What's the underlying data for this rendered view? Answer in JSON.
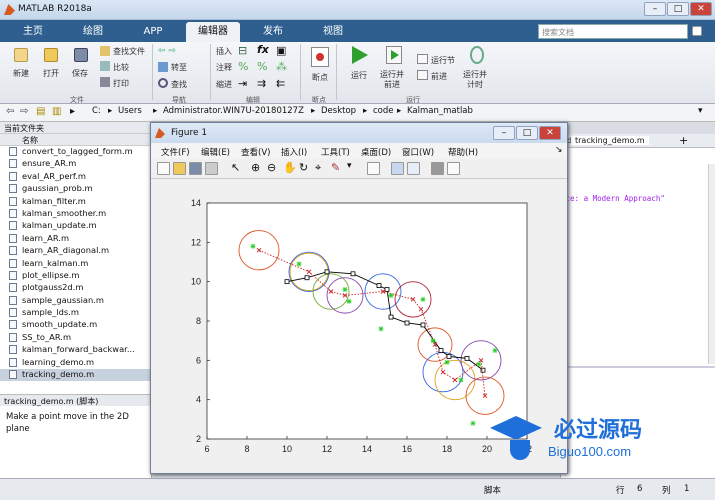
{
  "window": {
    "title": "MATLAB R2018a"
  },
  "tabs": [
    "主页",
    "绘图",
    "APP",
    "编辑器",
    "发布",
    "视图"
  ],
  "search": {
    "placeholder": "搜索文档"
  },
  "ribbon": {
    "file_group": {
      "new": "新建",
      "open": "打开",
      "save": "保存",
      "find_files": "查找文件",
      "compare": "比较",
      "print": "打印",
      "label": "文件"
    },
    "nav_group": {
      "goto": "转至",
      "find": "查找",
      "label": "导航"
    },
    "edit_group": {
      "insert": "插入",
      "comment": "注释",
      "indent": "缩进",
      "label": "编辑"
    },
    "breakpoint_group": {
      "breakpoints": "断点",
      "label": "断点"
    },
    "run_group": {
      "run": "运行",
      "run_advance": "运行并\n前进",
      "run_section": "运行节",
      "advance": "前进",
      "run_time": "运行并\n计时",
      "label": "运行"
    }
  },
  "address": {
    "parts": [
      "C:",
      "Users",
      "Administrator.WIN7U-20180127Z",
      "Desktop",
      "code",
      "Kalman_matlab"
    ]
  },
  "current_folder": {
    "title": "当前文件夹",
    "name_header": "名称",
    "files": [
      "convert_to_lagged_form.m",
      "ensure_AR.m",
      "eval_AR_perf.m",
      "gaussian_prob.m",
      "kalman_filter.m",
      "kalman_smoother.m",
      "kalman_update.m",
      "learn_AR.m",
      "learn_AR_diagonal.m",
      "learn_kalman.m",
      "plot_ellipse.m",
      "plotgauss2d.m",
      "sample_gaussian.m",
      "sample_lds.m",
      "smooth_update.m",
      "SS_to_AR.m",
      "kalman_forward_backwar...",
      "learning_demo.m",
      "tracking_demo.m"
    ],
    "selected": "tracking_demo.m"
  },
  "details": {
    "file": "tracking_demo.m",
    "kind": "(脚本)",
    "description": "Make a point move in the 2D plane"
  },
  "editor": {
    "tabs": [
      "_demo.m",
      "tracking_demo.m"
    ],
    "code_snippet": "nce: a Modern Approach\""
  },
  "status": {
    "mode": "脚本",
    "row_label": "行",
    "row": "6",
    "col_label": "列",
    "col": "1"
  },
  "figure": {
    "title": "Figure 1",
    "menu": [
      "文件(F)",
      "编辑(E)",
      "查看(V)",
      "插入(I)",
      "工具(T)",
      "桌面(D)",
      "窗口(W)",
      "帮助(H)"
    ]
  },
  "watermark": {
    "text": "必过源码",
    "url": "Biguo100.com"
  },
  "chart_data": {
    "type": "scatter",
    "xlim": [
      6,
      22
    ],
    "ylim": [
      2,
      14
    ],
    "xticks": [
      6,
      8,
      10,
      12,
      14,
      16,
      18,
      20,
      22
    ],
    "yticks": [
      2,
      4,
      6,
      8,
      10,
      12,
      14
    ],
    "series": [
      {
        "marker": "square",
        "style": "solid",
        "color": "#000000",
        "x": [
          10,
          11,
          12,
          13.3,
          14.6,
          15,
          15.2,
          16,
          16.8,
          17.7,
          18.1,
          19,
          19.8
        ],
        "y": [
          10,
          10.2,
          10.5,
          10.4,
          9.8,
          9.6,
          8.2,
          7.9,
          7.8,
          6.5,
          6.2,
          6.1,
          5.5
        ]
      },
      {
        "marker": "x",
        "style": "dotted",
        "color": "#cc2222",
        "x": [
          8.6,
          11.1,
          12.2,
          12.9,
          14.8,
          16.3,
          16.7,
          17.4,
          17.8,
          18.4,
          19.7,
          19.9
        ],
        "y": [
          11.6,
          10.5,
          9.5,
          9.3,
          9.5,
          9.1,
          8.6,
          6.8,
          5.4,
          5.0,
          6.0,
          4.2
        ]
      },
      {
        "marker": "asterisk",
        "color": "#22cc22",
        "x": [
          8.3,
          10.6,
          12.9,
          13.1,
          14.7,
          15.2,
          16.8,
          17.3,
          18.0,
          18.7,
          19.6,
          20.4,
          19.3
        ],
        "y": [
          11.8,
          10.9,
          9.6,
          9.0,
          7.6,
          9.3,
          9.1,
          7.0,
          5.9,
          5.0,
          5.8,
          6.5,
          2.8
        ]
      }
    ],
    "ellipses": [
      {
        "cx": 8.6,
        "cy": 11.6,
        "r": 1.0,
        "color": "#dd5522"
      },
      {
        "cx": 11.1,
        "cy": 10.5,
        "r": 1.0,
        "color": "#3366dd"
      },
      {
        "cx": 11.1,
        "cy": 10.5,
        "r": 0.95,
        "color": "#e0a020"
      },
      {
        "cx": 12.2,
        "cy": 9.5,
        "r": 0.9,
        "color": "#77aa33"
      },
      {
        "cx": 12.9,
        "cy": 9.3,
        "r": 0.9,
        "color": "#8844aa"
      },
      {
        "cx": 14.8,
        "cy": 9.5,
        "r": 0.9,
        "color": "#3366dd"
      },
      {
        "cx": 16.3,
        "cy": 9.1,
        "r": 0.9,
        "color": "#aa2233"
      },
      {
        "cx": 17.4,
        "cy": 6.8,
        "r": 0.85,
        "color": "#dd5522"
      },
      {
        "cx": 17.8,
        "cy": 5.4,
        "r": 1.0,
        "color": "#3366dd"
      },
      {
        "cx": 18.4,
        "cy": 5.0,
        "r": 1.0,
        "color": "#e0a020"
      },
      {
        "cx": 19.7,
        "cy": 6.0,
        "r": 1.0,
        "color": "#8844aa"
      },
      {
        "cx": 19.9,
        "cy": 4.2,
        "r": 0.95,
        "color": "#dd5522"
      }
    ]
  }
}
